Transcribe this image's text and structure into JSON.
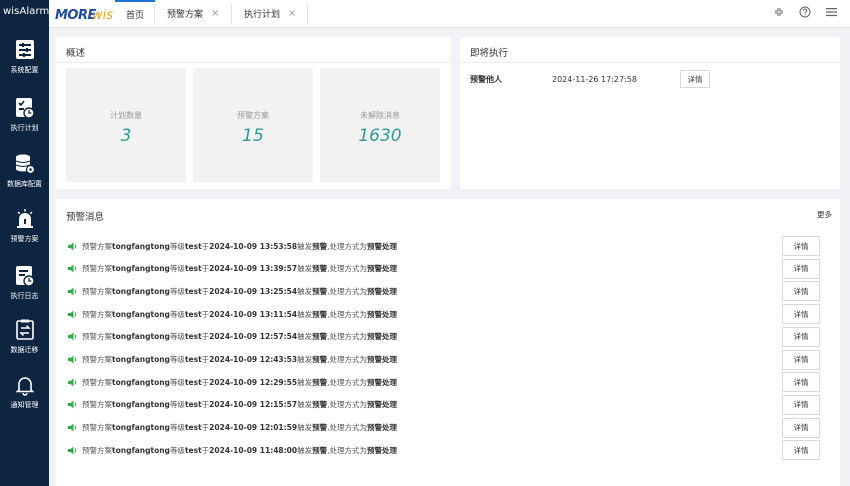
{
  "brand": {
    "name": "wisAlarm"
  },
  "logo": {
    "text": "MOREwis"
  },
  "sidebar": {
    "items": [
      {
        "label": "系统配置",
        "icon": "system-config-icon"
      },
      {
        "label": "执行计划",
        "icon": "execution-plan-icon"
      },
      {
        "label": "数据库配置",
        "icon": "database-config-icon"
      },
      {
        "label": "预警方案",
        "icon": "alarm-scheme-icon"
      },
      {
        "label": "执行日志",
        "icon": "execution-log-icon"
      },
      {
        "label": "数据迁移",
        "icon": "data-migration-icon"
      },
      {
        "label": "通知管理",
        "icon": "notification-bell-icon"
      }
    ]
  },
  "tabs": [
    {
      "label": "首页",
      "active": true
    },
    {
      "label": "预警方案",
      "closable": true
    },
    {
      "label": "执行计划",
      "closable": true
    }
  ],
  "tab_close_glyph": "×",
  "topbar_icons": [
    "fullscreen-icon",
    "help-icon",
    "menu-icon"
  ],
  "overview": {
    "title": "概述",
    "stats": [
      {
        "label": "计划数量",
        "value": "3"
      },
      {
        "label": "预警方案",
        "value": "15"
      },
      {
        "label": "未解除消息",
        "value": "1630"
      }
    ]
  },
  "upcoming": {
    "title": "即将执行",
    "items": [
      {
        "name": "预警他人",
        "time": "2024-11-26 17:27:58",
        "button": "详情"
      }
    ]
  },
  "alerts": {
    "title": "预警消息",
    "more": "更多",
    "button_label": "详情",
    "prefix": "预警方案",
    "scheme_name": "tongfangtong",
    "level_prefix": "等级",
    "level": "test",
    "time_prefix": "于",
    "trigger_text": "触发",
    "trigger_bold": "预警",
    "method_text": ",处理方式为",
    "method": "预警处理",
    "timestamps": [
      "2024-10-09 13:53:58",
      "2024-10-09 13:39:57",
      "2024-10-09 13:25:54",
      "2024-10-09 13:11:54",
      "2024-10-09 12:57:54",
      "2024-10-09 12:43:53",
      "2024-10-09 12:29:55",
      "2024-10-09 12:15:57",
      "2024-10-09 12:01:59",
      "2024-10-09 11:48:00"
    ]
  },
  "colors": {
    "sidebar": "#0e2541",
    "accent": "#2d9a94",
    "tab_active": "#1e6fd9",
    "speaker": "#3aa84a"
  }
}
